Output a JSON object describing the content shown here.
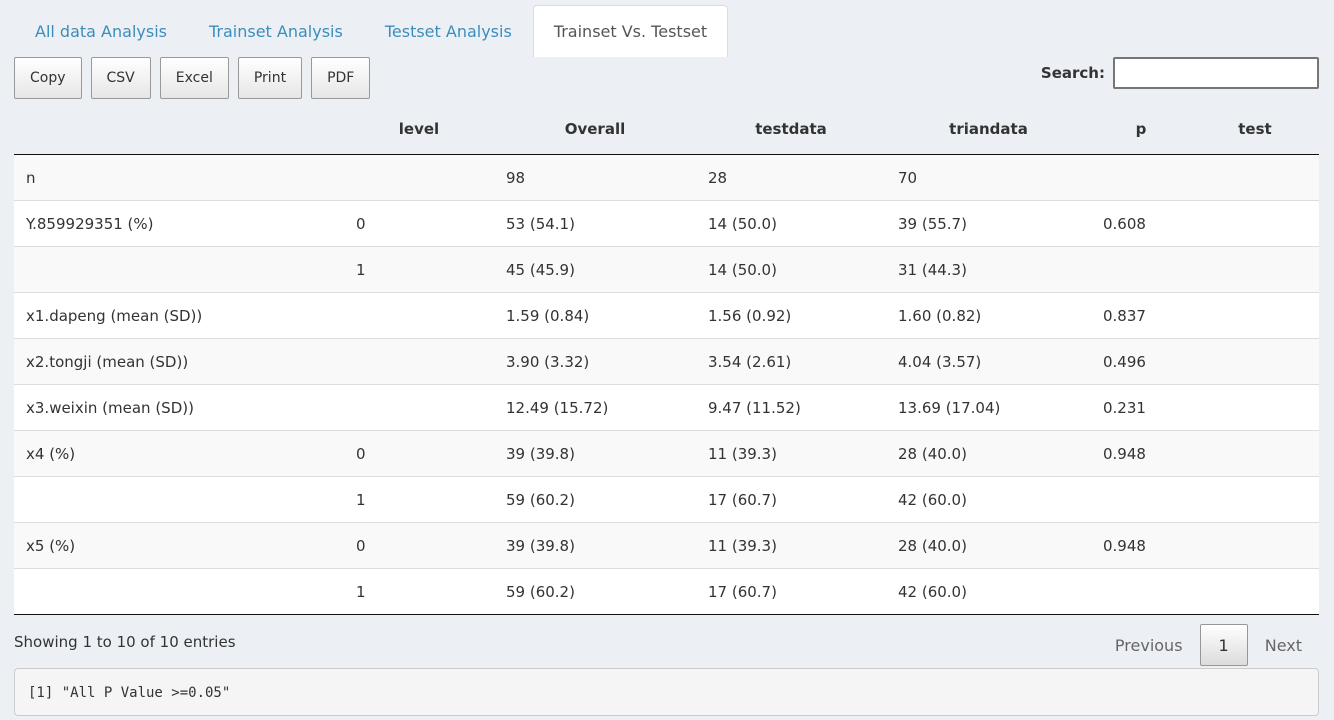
{
  "tabs": [
    {
      "label": "All data Analysis"
    },
    {
      "label": "Trainset Analysis"
    },
    {
      "label": "Testset Analysis"
    },
    {
      "label": "Trainset Vs. Testset"
    }
  ],
  "active_tab": "Trainset Vs. Testset",
  "buttons": [
    {
      "label": "Copy"
    },
    {
      "label": "CSV"
    },
    {
      "label": "Excel"
    },
    {
      "label": "Print"
    },
    {
      "label": "PDF"
    }
  ],
  "search": {
    "label": "Search:",
    "value": ""
  },
  "table": {
    "headers": [
      "",
      "level",
      "Overall",
      "testdata",
      "triandata",
      "p",
      "test"
    ],
    "rows": [
      [
        "n",
        "",
        "98",
        "28",
        "70",
        "",
        ""
      ],
      [
        "Y.859929351 (%)",
        "0",
        "53 (54.1)",
        "14 (50.0)",
        "39 (55.7)",
        "0.608",
        ""
      ],
      [
        "",
        "1",
        "45 (45.9)",
        "14 (50.0)",
        "31 (44.3)",
        "",
        ""
      ],
      [
        "x1.dapeng (mean (SD))",
        "",
        "1.59 (0.84)",
        "1.56 (0.92)",
        "1.60 (0.82)",
        "0.837",
        ""
      ],
      [
        "x2.tongji (mean (SD))",
        "",
        "3.90 (3.32)",
        "3.54 (2.61)",
        "4.04 (3.57)",
        "0.496",
        ""
      ],
      [
        "x3.weixin (mean (SD))",
        "",
        "12.49 (15.72)",
        "9.47 (11.52)",
        "13.69 (17.04)",
        "0.231",
        ""
      ],
      [
        "x4 (%)",
        "0",
        "39 (39.8)",
        "11 (39.3)",
        "28 (40.0)",
        "0.948",
        ""
      ],
      [
        "",
        "1",
        "59 (60.2)",
        "17 (60.7)",
        "42 (60.0)",
        "",
        ""
      ],
      [
        "x5 (%)",
        "0",
        "39 (39.8)",
        "11 (39.3)",
        "28 (40.0)",
        "0.948",
        ""
      ],
      [
        "",
        "1",
        "59 (60.2)",
        "17 (60.7)",
        "42 (60.0)",
        "",
        ""
      ]
    ]
  },
  "info": "Showing 1 to 10 of 10 entries",
  "pagination": {
    "previous": "Previous",
    "current": "1",
    "next": "Next"
  },
  "output": "[1] \"All P Value >=0.05\"",
  "colors": {
    "accent": "#3c8dbc",
    "background": "#ecf0f5"
  }
}
